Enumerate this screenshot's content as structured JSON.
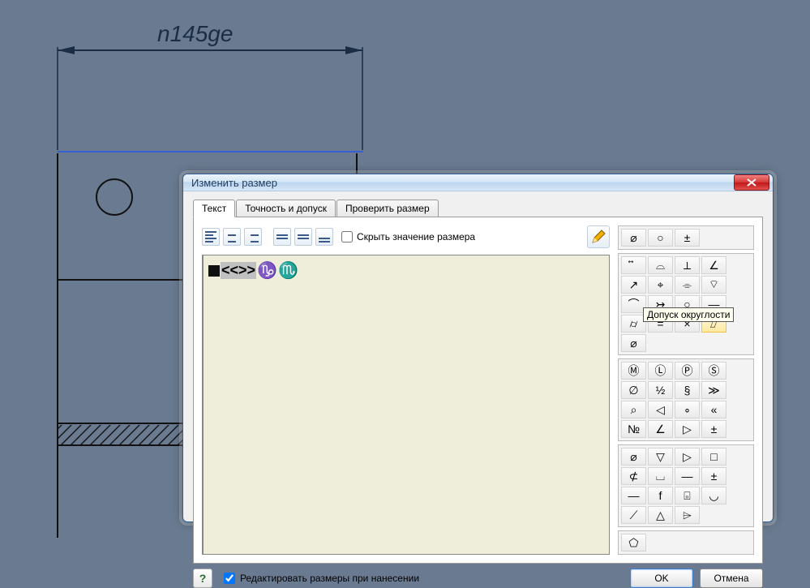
{
  "dimension": {
    "text": "n145ge"
  },
  "dialog": {
    "title": "Изменить размер",
    "tabs": [
      "Текст",
      "Точность и допуск",
      "Проверить размер"
    ],
    "active_tab": "Текст",
    "hide_dim_checkbox": "Скрыть значение размера",
    "editor": {
      "sel_text": "<<>>",
      "astro1": "♑",
      "astro2": "♏"
    },
    "tooltip": "Допуск округлости",
    "footer": {
      "edit_on_place": "Редактировать размеры при нанесении",
      "ok": "OK",
      "cancel": "Отмена"
    }
  },
  "symbols": {
    "g1": [
      "⌀",
      "○",
      "±"
    ],
    "g2_row1": [
      "⃡",
      "⌓",
      "⟂",
      "∠",
      "↗"
    ],
    "g2_row2": [
      "⌖",
      "⌯",
      "⌔",
      "⌒",
      "↣"
    ],
    "g2_row3": [
      "○",
      "—",
      "⌭",
      "=",
      "×"
    ],
    "g2_row4": [
      "⌰",
      "⌀"
    ],
    "g3": [
      "Ⓜ",
      "Ⓛ",
      "Ⓟ",
      "Ⓢ",
      "∅",
      "½",
      "§",
      "≫",
      "⌕",
      "◁",
      "∘",
      "«",
      "№",
      "∠",
      "▷",
      "±"
    ],
    "g4": [
      "⌀",
      "▽",
      "▷",
      "□",
      "⊄",
      "⌴",
      "—",
      "±",
      "—",
      "f",
      "⌻",
      "◡",
      "⟋",
      "△",
      "⌲"
    ],
    "g5": [
      "⬠"
    ]
  }
}
